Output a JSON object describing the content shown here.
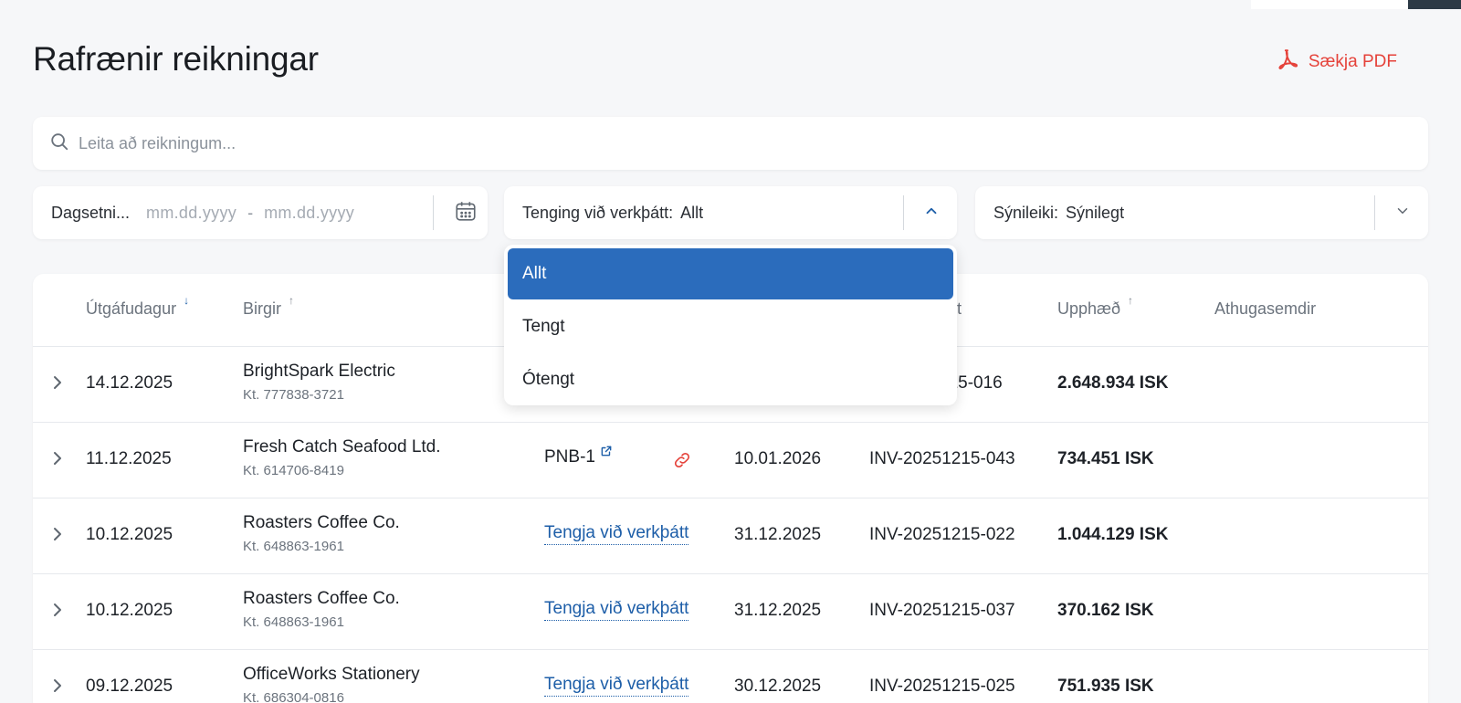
{
  "page": {
    "title": "Rafrænir reikningar"
  },
  "actions": {
    "pdf_label": "Sækja PDF"
  },
  "search": {
    "placeholder": "Leita að reikningum..."
  },
  "filters": {
    "date": {
      "label": "Dagsetni...",
      "from_placeholder": "mm.dd.yyyy",
      "separator": "-",
      "to_placeholder": "mm.dd.yyyy"
    },
    "project_link": {
      "label": "Tenging við verkþátt:",
      "value": "Allt",
      "options": [
        "Allt",
        "Tengt",
        "Ótengt"
      ],
      "selected": "Allt"
    },
    "visibility": {
      "label": "Sýnileiki:",
      "value": "Sýnilegt"
    }
  },
  "table": {
    "columns": {
      "issue_date": "Útgáfudagur",
      "supplier": "Birgir",
      "invoice_partial": "t",
      "amount": "Upphæð",
      "notes": "Athugasemdir"
    },
    "link_label": "Tengja við verkþátt",
    "rows": [
      {
        "issue_date": "14.12.2025",
        "supplier": "BrightSpark Electric",
        "kt": "Kt. 777838-3721",
        "invoice": "215-016",
        "amount": "2.648.934 ISK"
      },
      {
        "issue_date": "11.12.2025",
        "supplier": "Fresh Catch Seafood Ltd.",
        "kt": "Kt. 614706-8419",
        "project": "PNB-1",
        "due_date": "10.01.2026",
        "invoice": "INV-20251215-043",
        "amount": "734.451 ISK"
      },
      {
        "issue_date": "10.12.2025",
        "supplier": "Roasters Coffee Co.",
        "kt": "Kt. 648863-1961",
        "due_date": "31.12.2025",
        "invoice": "INV-20251215-022",
        "amount": "1.044.129 ISK"
      },
      {
        "issue_date": "10.12.2025",
        "supplier": "Roasters Coffee Co.",
        "kt": "Kt. 648863-1961",
        "due_date": "31.12.2025",
        "invoice": "INV-20251215-037",
        "amount": "370.162 ISK"
      },
      {
        "issue_date": "09.12.2025",
        "supplier": "OfficeWorks Stationery",
        "kt": "Kt. 686304-0816",
        "due_date": "30.12.2025",
        "invoice": "INV-20251215-025",
        "amount": "751.935 ISK"
      }
    ]
  },
  "colors": {
    "accent": "#2b6cbc",
    "link": "#1d5ea8",
    "danger": "#e5423a",
    "background": "#f6f7f9"
  }
}
